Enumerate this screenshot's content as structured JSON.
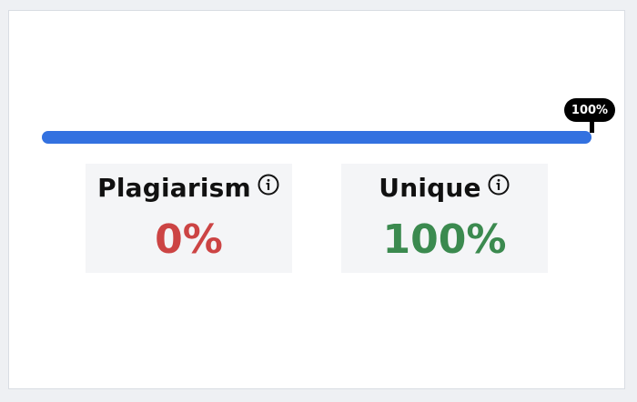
{
  "progress": {
    "value_percent": 100,
    "marker_label": "100%",
    "fill_color": "#3371e0",
    "track_color": "#e3e8f0"
  },
  "stats": [
    {
      "label": "Plagiarism",
      "value": "0%",
      "value_color": "#cc4444",
      "icon": "info-icon"
    },
    {
      "label": "Unique",
      "value": "100%",
      "value_color": "#3b8a4f",
      "icon": "info-icon"
    }
  ]
}
